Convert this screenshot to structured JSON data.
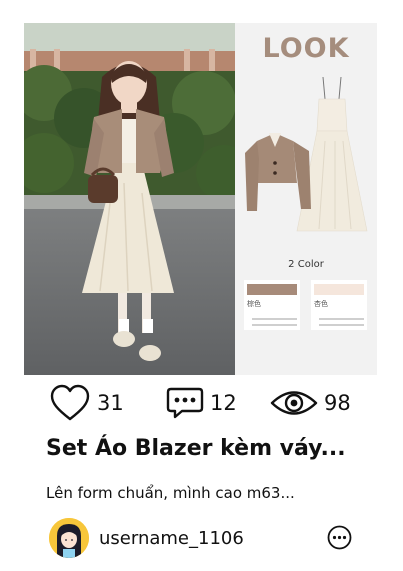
{
  "post": {
    "image_text": {
      "look": "LOOK",
      "color_count": "2 Color",
      "swatches": [
        {
          "name": "棕色",
          "color": "#a78b7a"
        },
        {
          "name": "杏色",
          "color": "#f5e6dc"
        }
      ]
    },
    "stats": {
      "likes": "31",
      "comments": "12",
      "views": "98"
    },
    "title": "Set Áo Blazer kèm váy...",
    "description": "Lên form chuẩn, mình cao m63...",
    "author": {
      "username": "username_1106"
    }
  },
  "colors": {
    "look_text": "#a58d7d",
    "blazer": "#a58a77",
    "dress": "#f1ebde",
    "avatar_bg": "#f7c63a"
  },
  "icons": {
    "like": "heart-icon",
    "comment": "comment-bubble-icon",
    "views": "eye-icon",
    "more": "more-options-icon"
  }
}
